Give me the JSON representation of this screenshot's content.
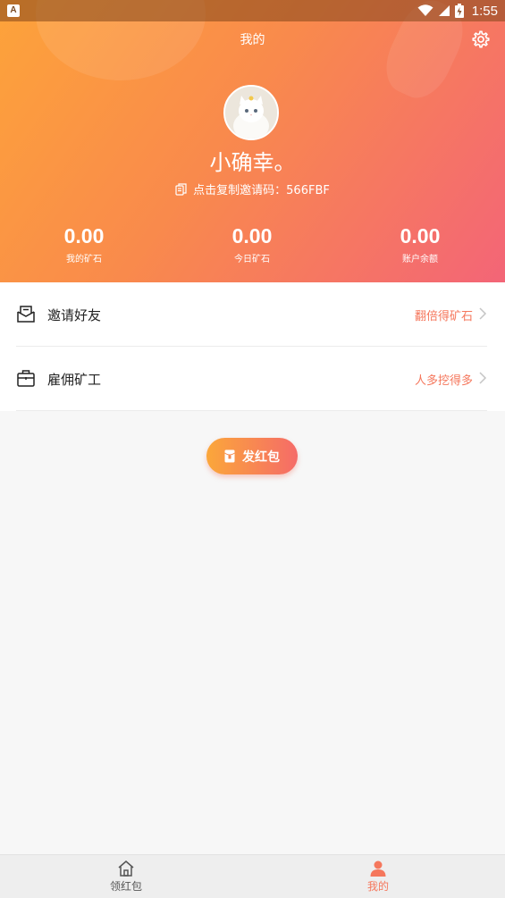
{
  "status_bar": {
    "time": "1:55",
    "app_icon": "A"
  },
  "header": {
    "title": "我的",
    "settings_icon": "gear-icon"
  },
  "profile": {
    "nickname": "小确幸。",
    "invite_text": "点击复制邀请码：566FBF",
    "copy_icon": "copy-icon"
  },
  "stats": [
    {
      "value": "0.00",
      "label": "我的矿石"
    },
    {
      "value": "0.00",
      "label": "今日矿石"
    },
    {
      "value": "0.00",
      "label": "账户余额"
    }
  ],
  "menu": [
    {
      "label": "邀请好友",
      "hint": "翻倍得矿石",
      "icon": "envelope-icon"
    },
    {
      "label": "雇佣矿工",
      "hint": "人多挖得多",
      "icon": "briefcase-icon"
    }
  ],
  "red_packet_button": {
    "label": "发红包"
  },
  "bottom_nav": [
    {
      "label": "领红包",
      "icon": "home-icon",
      "active": false
    },
    {
      "label": "我的",
      "icon": "person-icon",
      "active": true
    }
  ],
  "colors": {
    "gradient_start": "#fda33a",
    "gradient_end": "#f36577",
    "accent": "#f5775c",
    "nav_active": "#f5775c",
    "nav_inactive": "#555555"
  }
}
